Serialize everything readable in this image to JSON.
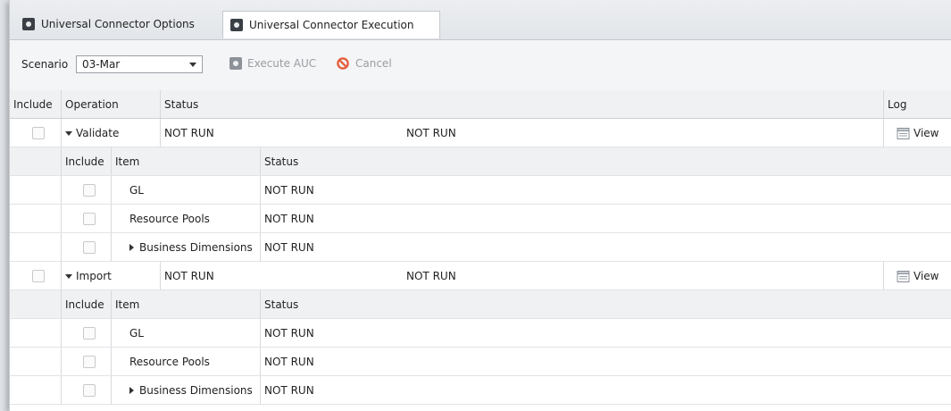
{
  "tabs": [
    {
      "label": "Universal Connector Options"
    },
    {
      "label": "Universal Connector Execution"
    }
  ],
  "toolbar": {
    "scenario_label": "Scenario",
    "scenario_value": "03-Mar",
    "execute_label": "Execute AUC",
    "cancel_label": "Cancel"
  },
  "grid": {
    "headers": {
      "include": "Include",
      "operation": "Operation",
      "status": "Status",
      "log": "Log"
    },
    "operations": [
      {
        "name": "Validate",
        "status": "NOT RUN",
        "status2": "NOT RUN",
        "log": "View",
        "sub_headers": {
          "include": "Include",
          "item": "Item",
          "status": "Status"
        },
        "items": [
          {
            "name": "GL",
            "status": "NOT RUN"
          },
          {
            "name": "Resource Pools",
            "status": "NOT RUN"
          },
          {
            "name": "Business Dimensions",
            "status": "NOT RUN"
          }
        ]
      },
      {
        "name": "Import",
        "status": "NOT RUN",
        "status2": "NOT RUN",
        "log": "View",
        "sub_headers": {
          "include": "Include",
          "item": "Item",
          "status": "Status"
        },
        "items": [
          {
            "name": "GL",
            "status": "NOT RUN"
          },
          {
            "name": "Resource Pools",
            "status": "NOT RUN"
          },
          {
            "name": "Business Dimensions",
            "status": "NOT RUN"
          }
        ]
      }
    ]
  }
}
